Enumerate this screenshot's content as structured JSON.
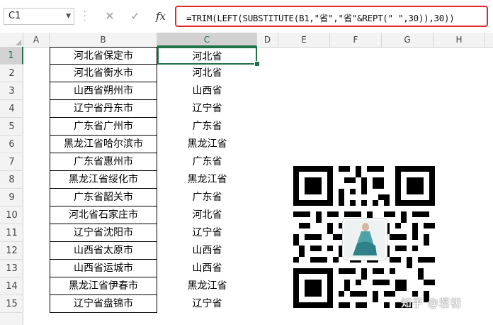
{
  "formula_bar": {
    "name_box": "C1",
    "cancel_icon": "✕",
    "enter_icon": "✓",
    "fx_label": "fx",
    "formula": "=TRIM(LEFT(SUBSTITUTE(B1,\"省\",\"省\"&REPT(\" \",30)),30))"
  },
  "columns": [
    "A",
    "B",
    "C",
    "D",
    "E",
    "F",
    "G",
    "H"
  ],
  "active_column": "C",
  "rows": [
    {
      "num": "1",
      "b": "河北省保定市",
      "c": "河北省"
    },
    {
      "num": "2",
      "b": "河北省衡水市",
      "c": "河北省"
    },
    {
      "num": "3",
      "b": "山西省朔州市",
      "c": "山西省"
    },
    {
      "num": "4",
      "b": "辽宁省丹东市",
      "c": "辽宁省"
    },
    {
      "num": "5",
      "b": "广东省广州市",
      "c": "广东省"
    },
    {
      "num": "6",
      "b": "黑龙江省哈尔滨市",
      "c": "黑龙江省"
    },
    {
      "num": "7",
      "b": "广东省惠州市",
      "c": "广东省"
    },
    {
      "num": "8",
      "b": "黑龙江省绥化市",
      "c": "黑龙江省"
    },
    {
      "num": "9",
      "b": "广东省韶关市",
      "c": "广东省"
    },
    {
      "num": "10",
      "b": "河北省石家庄市",
      "c": "河北省"
    },
    {
      "num": "11",
      "b": "辽宁省沈阳市",
      "c": "辽宁省"
    },
    {
      "num": "12",
      "b": "山西省太原市",
      "c": "山西省"
    },
    {
      "num": "13",
      "b": "山西省运城市",
      "c": "山西省"
    },
    {
      "num": "14",
      "b": "黑龙江省伊春市",
      "c": "黑龙江省"
    },
    {
      "num": "15",
      "b": "辽宁省盘锦市",
      "c": "辽宁省"
    }
  ],
  "watermark": "知乎 @若初",
  "colors": {
    "formula_highlight": "#e0282e",
    "selection": "#217346"
  }
}
